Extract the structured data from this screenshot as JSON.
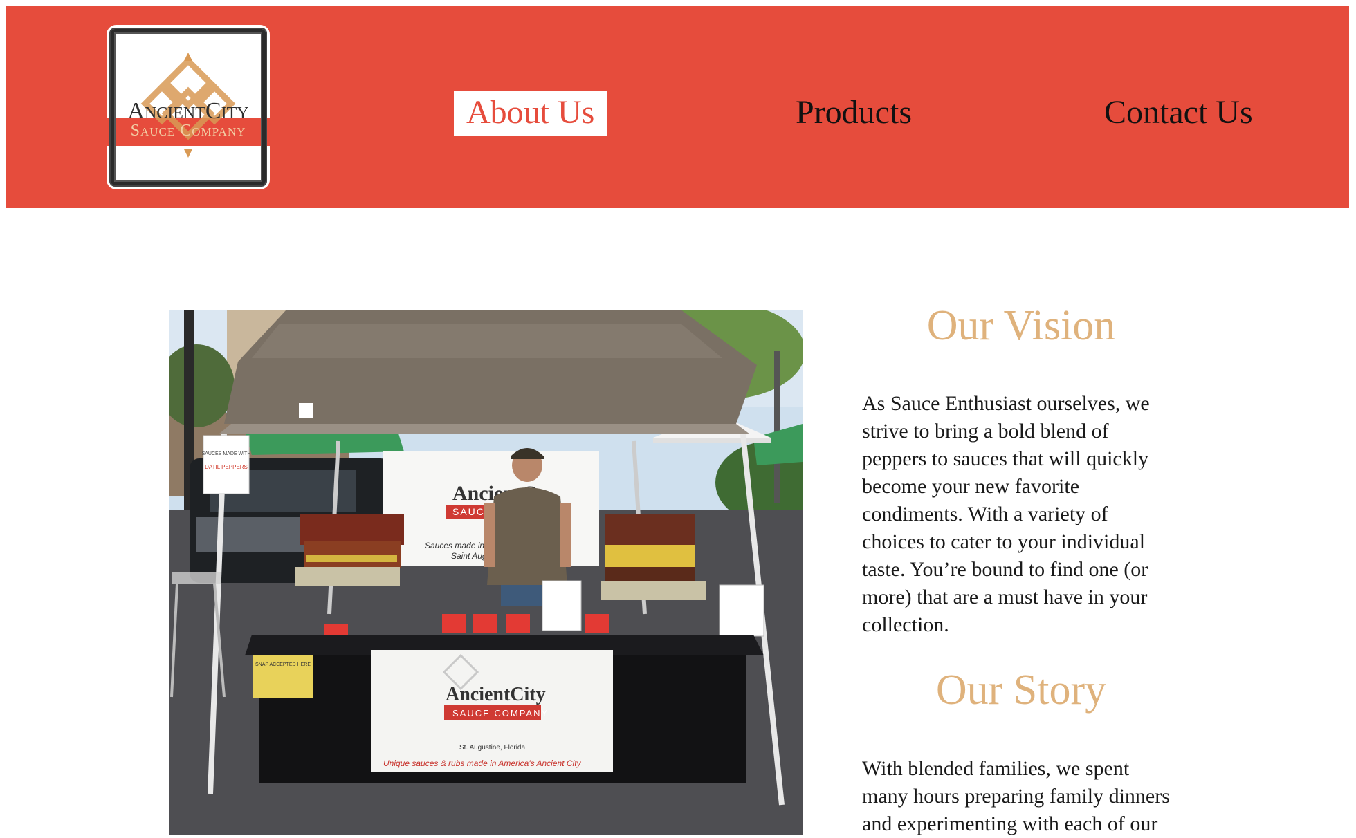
{
  "header": {
    "logo": {
      "line1": "AncientCity",
      "line2": "Sauce Company"
    },
    "nav": [
      {
        "label": "About Us",
        "active": true
      },
      {
        "label": "Products",
        "active": false
      },
      {
        "label": "Contact Us",
        "active": false
      }
    ],
    "colors": {
      "brand": "#e64c3c",
      "accent": "#dfb27c"
    }
  },
  "photo": {
    "banner_main": "AncientCity",
    "banner_sub": "SAUCE COMPANY",
    "banner_location": "St. Augustine, Florida",
    "banner_tagline": "Unique sauces & rubs made in America's Ancient City",
    "back_banner_main": "AncientC",
    "back_banner_sub": "SAUCE C",
    "back_banner_note": "Sauces made in the",
    "back_banner_note2": "Saint Aug",
    "sign_text": "SAUCES MADE WITH",
    "sign_text2": "DATIL PEPPERS",
    "snap_text": "SNAP ACCEPTED HERE"
  },
  "vision": {
    "title": "Our Vision",
    "lines": [
      "As Sauce Enthusiast ourselves, we",
      "strive to bring a bold blend of",
      "peppers to sauces that will quickly",
      "become your new favorite",
      "condiments. With a variety of",
      "choices to cater to your individual",
      "taste. You’re bound to find one (or",
      "more) that are a must have in your",
      "collection."
    ]
  },
  "story": {
    "title": "Our Story",
    "lines": [
      "With blended families, we spent",
      "many hours preparing family dinners",
      "and experimenting with each of our"
    ]
  }
}
